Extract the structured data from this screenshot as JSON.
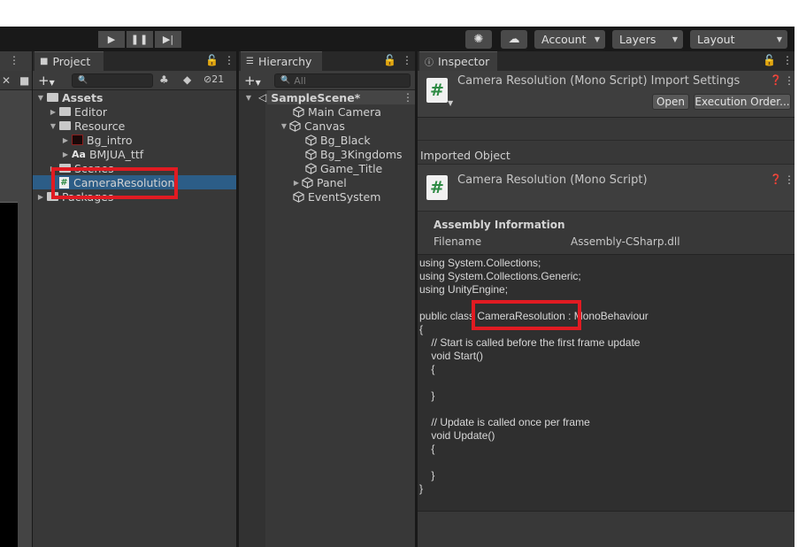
{
  "toolbar": {
    "account_label": "Account",
    "layers_label": "Layers",
    "layout_label": "Layout",
    "play_icon": "play-icon",
    "pause_icon": "pause-icon",
    "step_icon": "step-icon"
  },
  "project": {
    "tab_label": "Project",
    "search_placeholder": "",
    "hidden_count": "21",
    "tree": [
      {
        "label": "Assets",
        "depth": 0,
        "expanded": true
      },
      {
        "label": "Editor",
        "depth": 1
      },
      {
        "label": "Resource",
        "depth": 1,
        "expanded": true
      },
      {
        "label": "Bg_intro",
        "depth": 2
      },
      {
        "label": "BMJUA_ttf",
        "depth": 2,
        "prefix": "Aa"
      },
      {
        "label": "Scenes",
        "depth": 1
      },
      {
        "label": "CameraResolution",
        "depth": 1,
        "selected": true
      },
      {
        "label": "Packages",
        "depth": 0
      }
    ]
  },
  "hierarchy": {
    "tab_label": "Hierarchy",
    "search_placeholder": "All",
    "scene_name": "SampleScene*",
    "items": [
      {
        "label": "Main Camera",
        "depth": 1
      },
      {
        "label": "Canvas",
        "depth": 1,
        "expanded": true
      },
      {
        "label": "Bg_Black",
        "depth": 2
      },
      {
        "label": "Bg_3Kingdoms",
        "depth": 2
      },
      {
        "label": "Game_Title",
        "depth": 2
      },
      {
        "label": "Panel",
        "depth": 2,
        "collapsed": true
      },
      {
        "label": "EventSystem",
        "depth": 1
      }
    ]
  },
  "inspector": {
    "tab_label": "Inspector",
    "title": "Camera Resolution (Mono Script) Import Settings",
    "open_button": "Open",
    "execution_order_button": "Execution Order...",
    "imported_object_label": "Imported Object",
    "object_title": "Camera Resolution (Mono Script)",
    "assembly_info_label": "Assembly Information",
    "filename_label": "Filename",
    "filename_value": "Assembly-CSharp.dll",
    "code_lines": [
      "using System.Collections;",
      "using System.Collections.Generic;",
      "using UnityEngine;",
      "",
      "public class CameraResolution : MonoBehaviour",
      "{",
      "    // Start is called before the first frame update",
      "    void Start()",
      "    {",
      "",
      "    }",
      "",
      "    // Update is called once per frame",
      "    void Update()",
      "    {",
      "",
      "    }",
      "}"
    ]
  },
  "colors": {
    "highlight_red": "#e11b22",
    "selection_blue": "#2c5d87",
    "script_icon_green": "#2d8a43"
  }
}
